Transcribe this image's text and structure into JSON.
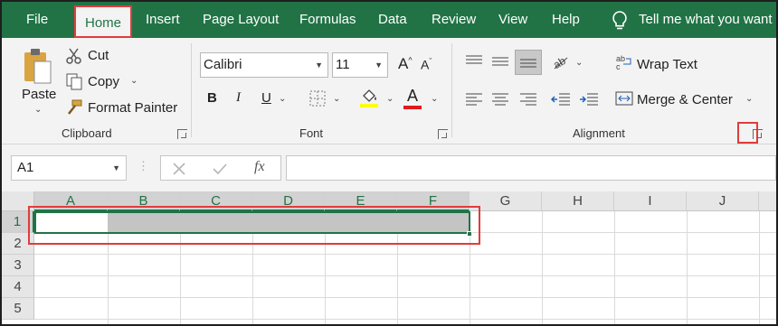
{
  "tabs": [
    "File",
    "Home",
    "Insert",
    "Page Layout",
    "Formulas",
    "Data",
    "Review",
    "View",
    "Help"
  ],
  "tell_me": "Tell me what you want",
  "clipboard": {
    "paste": "Paste",
    "cut": "Cut",
    "copy": "Copy",
    "format_painter": "Format Painter",
    "label": "Clipboard"
  },
  "font": {
    "name": "Calibri",
    "size": "11",
    "bold": "B",
    "italic": "I",
    "underline": "U",
    "label": "Font",
    "highlight_color": "#ffff00",
    "font_color": "#e01b1b"
  },
  "alignment": {
    "wrap_text": "Wrap Text",
    "merge_center": "Merge & Center",
    "label": "Alignment"
  },
  "formula_bar": {
    "name_box": "A1",
    "fx": "fx",
    "formula": ""
  },
  "sheet": {
    "columns": [
      "A",
      "B",
      "C",
      "D",
      "E",
      "F",
      "G",
      "H",
      "I",
      "J"
    ],
    "rows": [
      "1",
      "2",
      "3",
      "4",
      "5"
    ]
  },
  "colors": {
    "accent": "#217346",
    "highlight_outline": "#e03c3c",
    "selection_fill": "#c4c4c4"
  }
}
